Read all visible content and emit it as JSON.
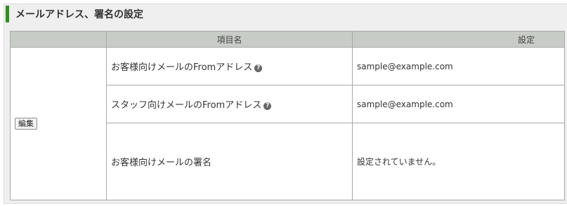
{
  "section": {
    "title": "メールアドレス、署名の設定",
    "accent_color": "#2f8f1f"
  },
  "table": {
    "headers": {
      "item_name": "項目名",
      "setting": "設定"
    },
    "edit_label": "編集",
    "rows": [
      {
        "label": "お客様向けメールのFromアドレス",
        "help": "?",
        "value": "sample@example.com"
      },
      {
        "label": "スタッフ向けメールのFromアドレス",
        "help": "?",
        "value": "sample@example.com"
      },
      {
        "label": "お客様向けメールの署名",
        "value": "設定されていません。"
      }
    ]
  }
}
